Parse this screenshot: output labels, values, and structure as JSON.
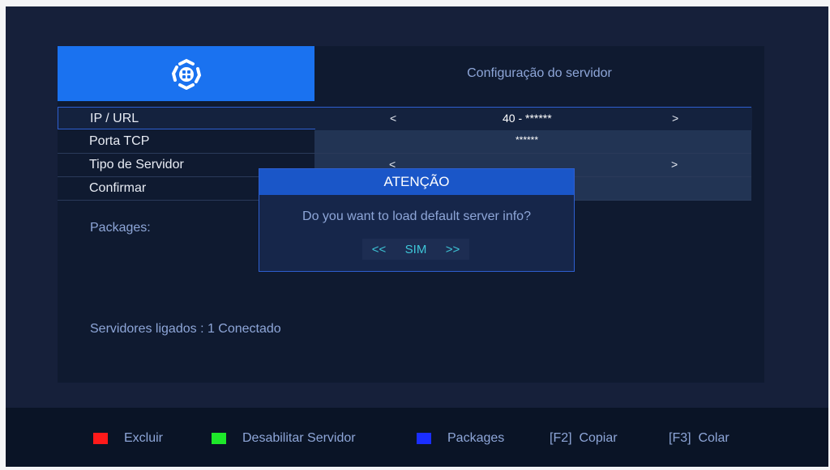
{
  "header": {
    "title": "Configuração do servidor",
    "logo_icon": "gear-badge-icon",
    "brand_color": "#1a72f0"
  },
  "rows": [
    {
      "label": "IP / URL",
      "value": "40 - ******",
      "has_arrows": true
    },
    {
      "label": "Porta TCP",
      "value": "******",
      "has_arrows": false
    },
    {
      "label": "Tipo de Servidor",
      "value": "",
      "has_arrows": true
    },
    {
      "label": "Confirmar",
      "value": "",
      "has_arrows": false
    }
  ],
  "arrows": {
    "left": "<",
    "right": ">"
  },
  "packages_label": "Packages:",
  "status": {
    "text": "Servidores ligados : 1   Conectado"
  },
  "dialog": {
    "title": "ATENÇÃO",
    "message": "Do you want to load default server info?",
    "left": "<<",
    "choice": "SIM",
    "right": ">>"
  },
  "footer": {
    "items": [
      {
        "label": "Excluir",
        "color": "#ff1a1a"
      },
      {
        "label": "Desabilitar Servidor",
        "color": "#1ee82a"
      },
      {
        "label": "Packages",
        "color": "#1a2eff"
      },
      {
        "label": "[F2]  Copiar"
      },
      {
        "label": "[F3]  Colar"
      }
    ]
  }
}
